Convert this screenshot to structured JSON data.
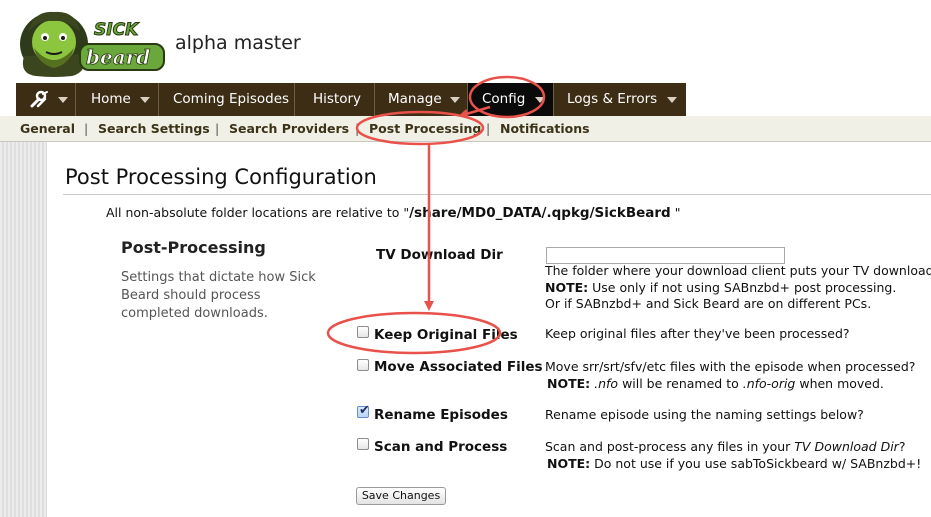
{
  "app": {
    "logo_text_top": "SICK",
    "logo_text_bottom": "beard",
    "title": "alpha master"
  },
  "nav": {
    "tools_icon": "wrench-screwdriver-icon",
    "items": [
      {
        "label": "Home"
      },
      {
        "label": "Coming Episodes"
      },
      {
        "label": "History"
      },
      {
        "label": "Manage"
      },
      {
        "label": "Config"
      },
      {
        "label": "Logs & Errors"
      }
    ]
  },
  "subnav": {
    "items": [
      {
        "label": "General"
      },
      {
        "label": "Search Settings"
      },
      {
        "label": "Search Providers"
      },
      {
        "label": "Post Processing"
      },
      {
        "label": "Notifications"
      }
    ],
    "separator": "|"
  },
  "page": {
    "title": "Post Processing Configuration",
    "path_note_prefix": "All non-absolute folder locations are relative to \"",
    "path_note_path": "/share/MD0_DATA/.qpkg/SickBeard",
    "path_note_suffix": "\""
  },
  "section": {
    "heading": "Post-Processing",
    "description": "Settings that dictate how Sick Beard should process completed downloads."
  },
  "options": {
    "tv_download_dir": {
      "label": "TV Download Dir",
      "value": "",
      "desc1": "The folder where your download client puts your TV downloads.",
      "desc2_note": "NOTE:",
      "desc2": " Use only if not using SABnzbd+ post processing.",
      "desc3": "Or if SABnzbd+ and Sick Beard are on different PCs."
    },
    "keep_original_files": {
      "label": "Keep Original Files",
      "checked": false,
      "desc1": "Keep original files after they've been processed?"
    },
    "move_associated_files": {
      "label": "Move Associated Files",
      "checked": false,
      "desc1": "Move srr/srt/sfv/etc files with the episode when processed?",
      "desc2_note": "NOTE:",
      "desc2_a": " ",
      "desc2_ext1": ".nfo",
      "desc2_b": " will be renamed to ",
      "desc2_ext2": ".nfo-orig",
      "desc2_c": " when moved."
    },
    "rename_episodes": {
      "label": "Rename Episodes",
      "checked": true,
      "desc1": "Rename episode using the naming settings below?"
    },
    "scan_and_process": {
      "label": "Scan and Process",
      "checked": false,
      "desc1_a": "Scan and post-process any files in your ",
      "desc1_em": "TV Download Dir",
      "desc1_b": "?",
      "desc2_note": "NOTE:",
      "desc2": " Do not use if you use sabToSickbeard w/ SABnzbd+!"
    }
  },
  "save_button": "Save Changes",
  "colors": {
    "nav_bg": "#3d2d15",
    "nav_active_bg": "#0a0a0a",
    "subnav_bg": "#f0f0e6",
    "annotation": "#e8524a",
    "logo_green": "#6aa83b"
  }
}
